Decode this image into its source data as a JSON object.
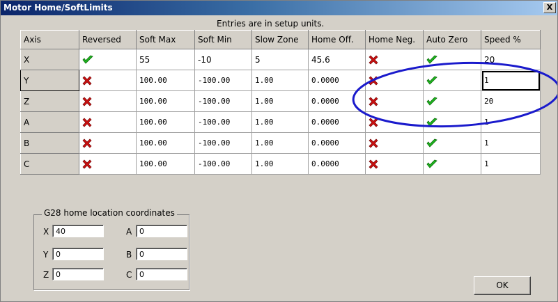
{
  "window": {
    "title": "Motor Home/SoftLimits",
    "close_label": "X"
  },
  "grid": {
    "caption": "Entries are in setup units.",
    "columns": [
      "Axis",
      "Reversed",
      "Soft Max",
      "Soft Min",
      "Slow Zone",
      "Home Off.",
      "Home Neg.",
      "Auto Zero",
      "Speed %"
    ],
    "rows": [
      {
        "axis": "X",
        "reversed": "check",
        "soft_max": "55",
        "soft_min": "-10",
        "slow_zone": "5",
        "home_off": "45.6",
        "home_neg": "cross",
        "auto_zero": "check",
        "speed": "20"
      },
      {
        "axis": "Y",
        "reversed": "cross",
        "soft_max": "100.00",
        "soft_min": "-100.00",
        "slow_zone": "1.00",
        "home_off": "0.0000",
        "home_neg": "cross",
        "auto_zero": "check",
        "speed": "1"
      },
      {
        "axis": "Z",
        "reversed": "cross",
        "soft_max": "100.00",
        "soft_min": "-100.00",
        "slow_zone": "1.00",
        "home_off": "0.0000",
        "home_neg": "cross",
        "auto_zero": "check",
        "speed": "20"
      },
      {
        "axis": "A",
        "reversed": "cross",
        "soft_max": "100.00",
        "soft_min": "-100.00",
        "slow_zone": "1.00",
        "home_off": "0.0000",
        "home_neg": "cross",
        "auto_zero": "check",
        "speed": "1"
      },
      {
        "axis": "B",
        "reversed": "cross",
        "soft_max": "100.00",
        "soft_min": "-100.00",
        "slow_zone": "1.00",
        "home_off": "0.0000",
        "home_neg": "cross",
        "auto_zero": "check",
        "speed": "1"
      },
      {
        "axis": "C",
        "reversed": "cross",
        "soft_max": "100.00",
        "soft_min": "-100.00",
        "slow_zone": "1.00",
        "home_off": "0.0000",
        "home_neg": "cross",
        "auto_zero": "check",
        "speed": "1"
      }
    ]
  },
  "g28": {
    "label": "G28 home location coordinates",
    "fields": [
      {
        "axis": "X",
        "value": "40"
      },
      {
        "axis": "Y",
        "value": "0"
      },
      {
        "axis": "Z",
        "value": "0"
      },
      {
        "axis": "A",
        "value": "0"
      },
      {
        "axis": "B",
        "value": "0"
      },
      {
        "axis": "C",
        "value": "0"
      }
    ]
  },
  "buttons": {
    "ok": "OK"
  },
  "icons": {
    "check": "check-icon",
    "cross": "cross-icon",
    "annotation": "blue-ellipse-annotation"
  },
  "colors": {
    "check": "#1fb81f",
    "cross": "#cc1010",
    "annotation": "#1a1acc",
    "title_bar": "#0a246a",
    "dialog": "#d4d0c8"
  }
}
